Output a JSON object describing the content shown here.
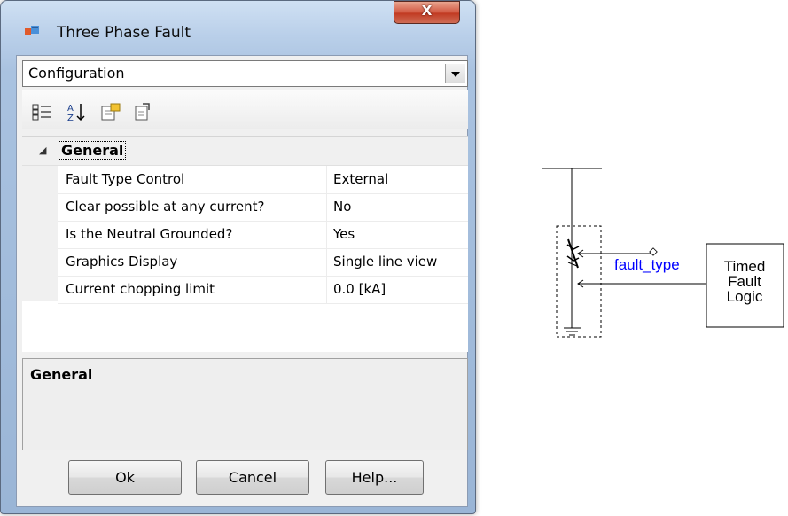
{
  "dialog": {
    "title": "Three Phase Fault",
    "close_label": "X",
    "view_select": {
      "value": "Configuration"
    },
    "toolbar": {
      "icons": [
        "categorized-icon",
        "alphabetical-sort-icon",
        "property-pages-icon",
        "export-icon"
      ]
    },
    "category": {
      "glyph": "◢",
      "label": "General"
    },
    "properties": [
      {
        "name": "Fault Type Control",
        "value": "External"
      },
      {
        "name": "Clear possible at any current?",
        "value": "No"
      },
      {
        "name": "Is the Neutral Grounded?",
        "value": "Yes"
      },
      {
        "name": "Graphics Display",
        "value": "Single line view"
      },
      {
        "name": "Current chopping limit",
        "value": "0.0 [kA]"
      }
    ],
    "help": {
      "title": "General"
    },
    "buttons": {
      "ok": "Ok",
      "cancel": "Cancel",
      "help": "Help..."
    }
  },
  "schematic": {
    "signal_label": "fault_type",
    "logic_box_lines": [
      "Timed",
      "Fault",
      "Logic"
    ],
    "colors": {
      "signal": "#0000ff",
      "wire": "#000000"
    }
  }
}
